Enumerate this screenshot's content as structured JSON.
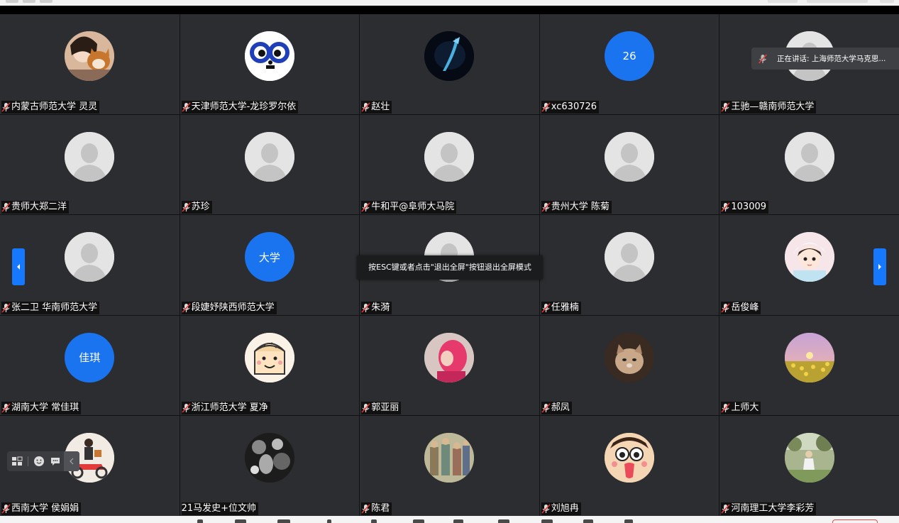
{
  "tooltip_text": "按ESC键或者点击\"退出全屏\"按钮退出全屏模式",
  "speaking": {
    "text": "正在讲话: 上海师范大学马克思..."
  },
  "accent_color": "#1677ff",
  "participants": [
    {
      "name": "内蒙古师范大学  灵灵",
      "avatar": "photo-girl-dog"
    },
    {
      "name": "天津师范大学-龙珍罗尔依",
      "avatar": "cartoon-glasses"
    },
    {
      "name": "赵壮",
      "avatar": "photo-dark-fish"
    },
    {
      "name": "xc630726",
      "avatar_text": "26"
    },
    {
      "name": "王驰—赣南师范大学",
      "avatar": "default"
    },
    {
      "name": "贵师大郑二洋",
      "avatar": "default"
    },
    {
      "name": "苏珍",
      "avatar": "default"
    },
    {
      "name": "牛和平@阜师大马院",
      "avatar": "default"
    },
    {
      "name": "贵州大学 陈菊",
      "avatar": "default"
    },
    {
      "name": "103009",
      "avatar": "default"
    },
    {
      "name": "张二卫 华南师范大学",
      "avatar": "default"
    },
    {
      "name": "段婕妤陕西师范大学",
      "avatar_text": "大学"
    },
    {
      "name": "朱漪",
      "avatar": "default"
    },
    {
      "name": "任雅楠",
      "avatar": "default"
    },
    {
      "name": "岳俊峰",
      "avatar": "anime-girl"
    },
    {
      "name": "湖南大学 常佳琪",
      "avatar_text": "佳琪"
    },
    {
      "name": "浙江师范大学 夏净",
      "avatar": "cartoon-bread"
    },
    {
      "name": "郭亚丽",
      "avatar": "photo-pink"
    },
    {
      "name": "郝凤",
      "avatar": "photo-cat"
    },
    {
      "name": "上师大",
      "avatar": "photo-sunset-flowers"
    },
    {
      "name": "西南大学 侯娟娟",
      "avatar": "cartoon-scooter"
    },
    {
      "name": "21马发史+位文帅",
      "avatar": "photo-bw"
    },
    {
      "name": "陈君",
      "avatar": "painting"
    },
    {
      "name": "刘旭冉",
      "avatar": "cartoon-tongue"
    },
    {
      "name": "河南理工大学李彩芳",
      "avatar": "photo-child-field"
    }
  ]
}
